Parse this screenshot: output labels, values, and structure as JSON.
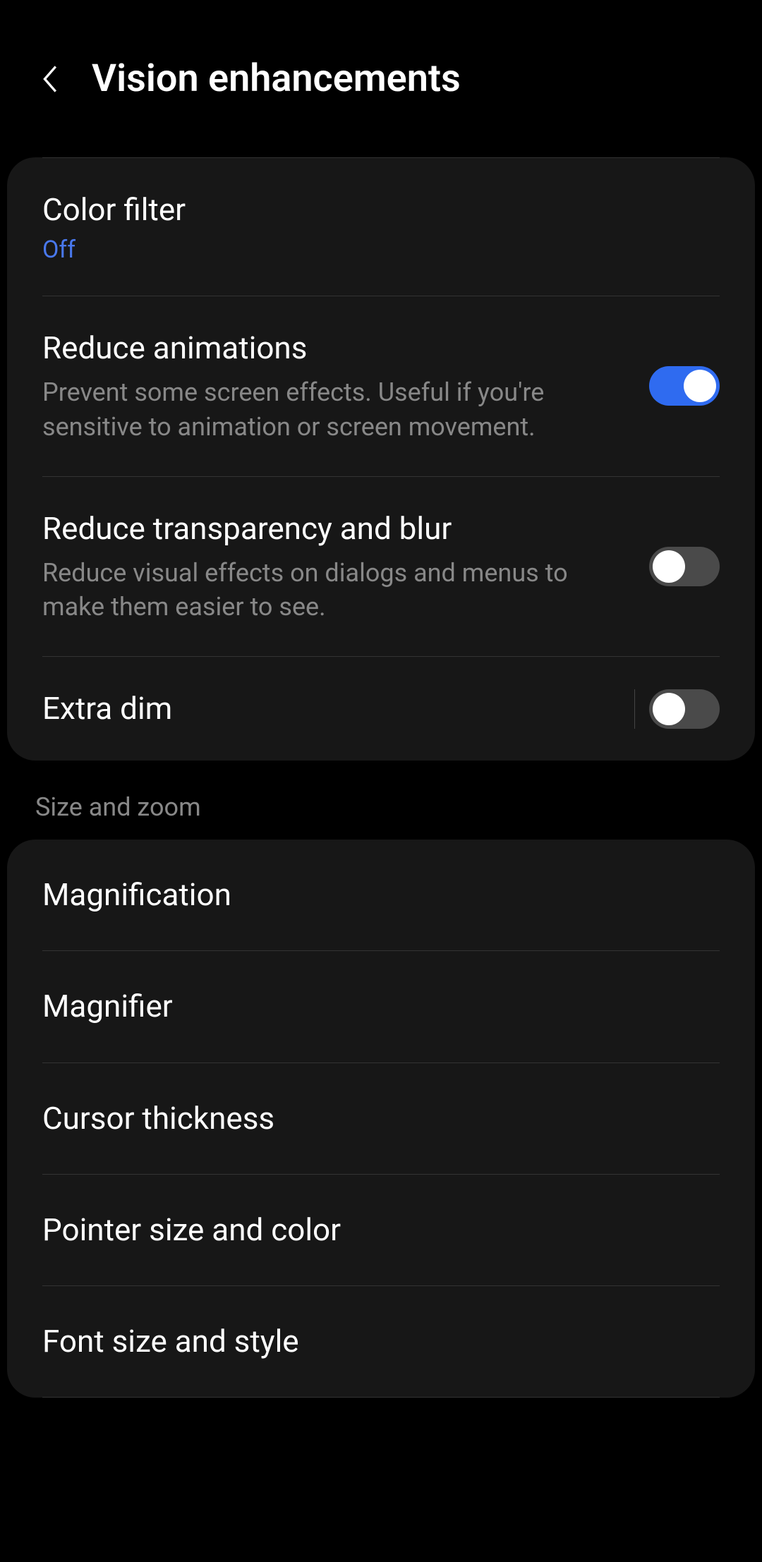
{
  "header": {
    "title": "Vision enhancements"
  },
  "section1": {
    "color_filter": {
      "title": "Color filter",
      "status": "Off"
    },
    "reduce_animations": {
      "title": "Reduce animations",
      "description": "Prevent some screen effects. Useful if you're sensitive to animation or screen movement.",
      "enabled": true
    },
    "reduce_transparency": {
      "title": "Reduce transparency and blur",
      "description": "Reduce visual effects on dialogs and menus to make them easier to see.",
      "enabled": false
    },
    "extra_dim": {
      "title": "Extra dim",
      "enabled": false
    }
  },
  "section2": {
    "label": "Size and zoom",
    "magnification": {
      "title": "Magnification"
    },
    "magnifier": {
      "title": "Magnifier"
    },
    "cursor_thickness": {
      "title": "Cursor thickness"
    },
    "pointer_size": {
      "title": "Pointer size and color"
    },
    "font_size": {
      "title": "Font size and style"
    }
  }
}
